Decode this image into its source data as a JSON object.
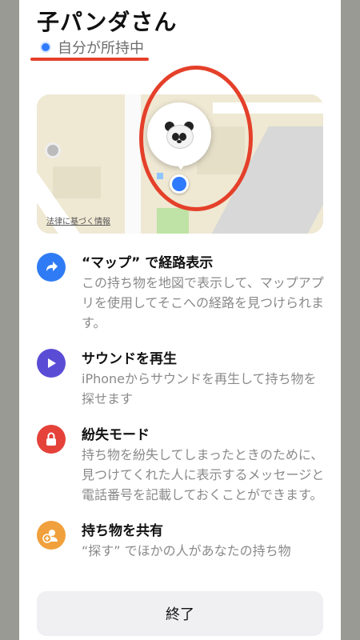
{
  "item": {
    "title": "子パンダさん",
    "status": "自分が所持中"
  },
  "map": {
    "legal_link": "法律に基づく情報"
  },
  "actions": [
    {
      "title": "“マップ” で経路表示",
      "description": "この持ち物を地図で表示して、マップアプリを使用してそこへの経路を見つけられます。",
      "icon": "directions-arrow-icon",
      "color": "#2f7bf5"
    },
    {
      "title": "サウンドを再生",
      "description": "iPhoneからサウンドを再生して持ち物を探せます",
      "icon": "play-icon",
      "color": "#5b4cd6"
    },
    {
      "title": "紛失モード",
      "description": "持ち物を紛失してしまったときのために、見つけてくれた人に表示するメッセージと電話番号を記載しておくことができます。",
      "icon": "lock-icon",
      "color": "#e5423a"
    },
    {
      "title": "持ち物を共有",
      "description": "“探す” でほかの人があなたの持ち物",
      "icon": "add-person-icon",
      "color": "#f0a03c"
    }
  ],
  "footer": {
    "done_label": "終了"
  }
}
